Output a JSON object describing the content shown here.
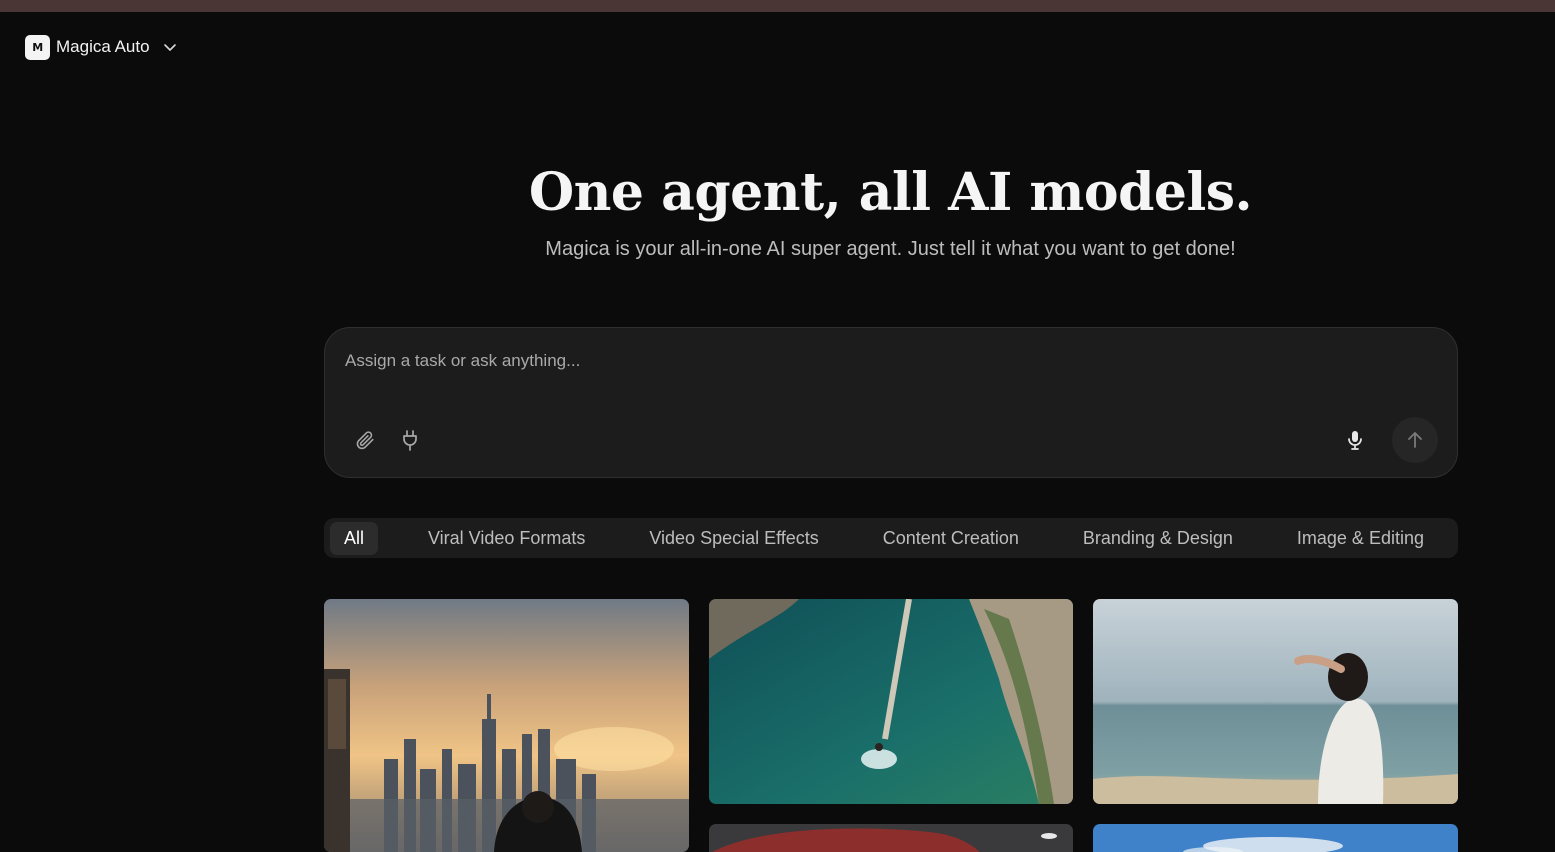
{
  "app": {
    "model_selector": {
      "logo_letter": "M",
      "label": "Magica Auto"
    }
  },
  "hero": {
    "title": "One agent, all AI models.",
    "subtitle": "Magica is your all-in-one AI super agent. Just tell it what you want to get done!"
  },
  "composer": {
    "placeholder": "Assign a task or ask anything...",
    "value": "",
    "icons": [
      "paperclip-icon",
      "plug-icon",
      "microphone-icon",
      "arrow-up-icon"
    ]
  },
  "categories": [
    {
      "label": "All",
      "active": true
    },
    {
      "label": "Viral Video Formats",
      "active": false
    },
    {
      "label": "Video Special Effects",
      "active": false
    },
    {
      "label": "Content Creation",
      "active": false
    },
    {
      "label": "Branding & Design",
      "active": false
    },
    {
      "label": "Image & Editing",
      "active": false
    }
  ],
  "colors": {
    "background": "#0b0b0b",
    "surface": "#1c1c1c",
    "active_tab": "#2c2c2c",
    "text_primary": "#f5f5f5",
    "text_secondary": "#bdbdbd"
  }
}
